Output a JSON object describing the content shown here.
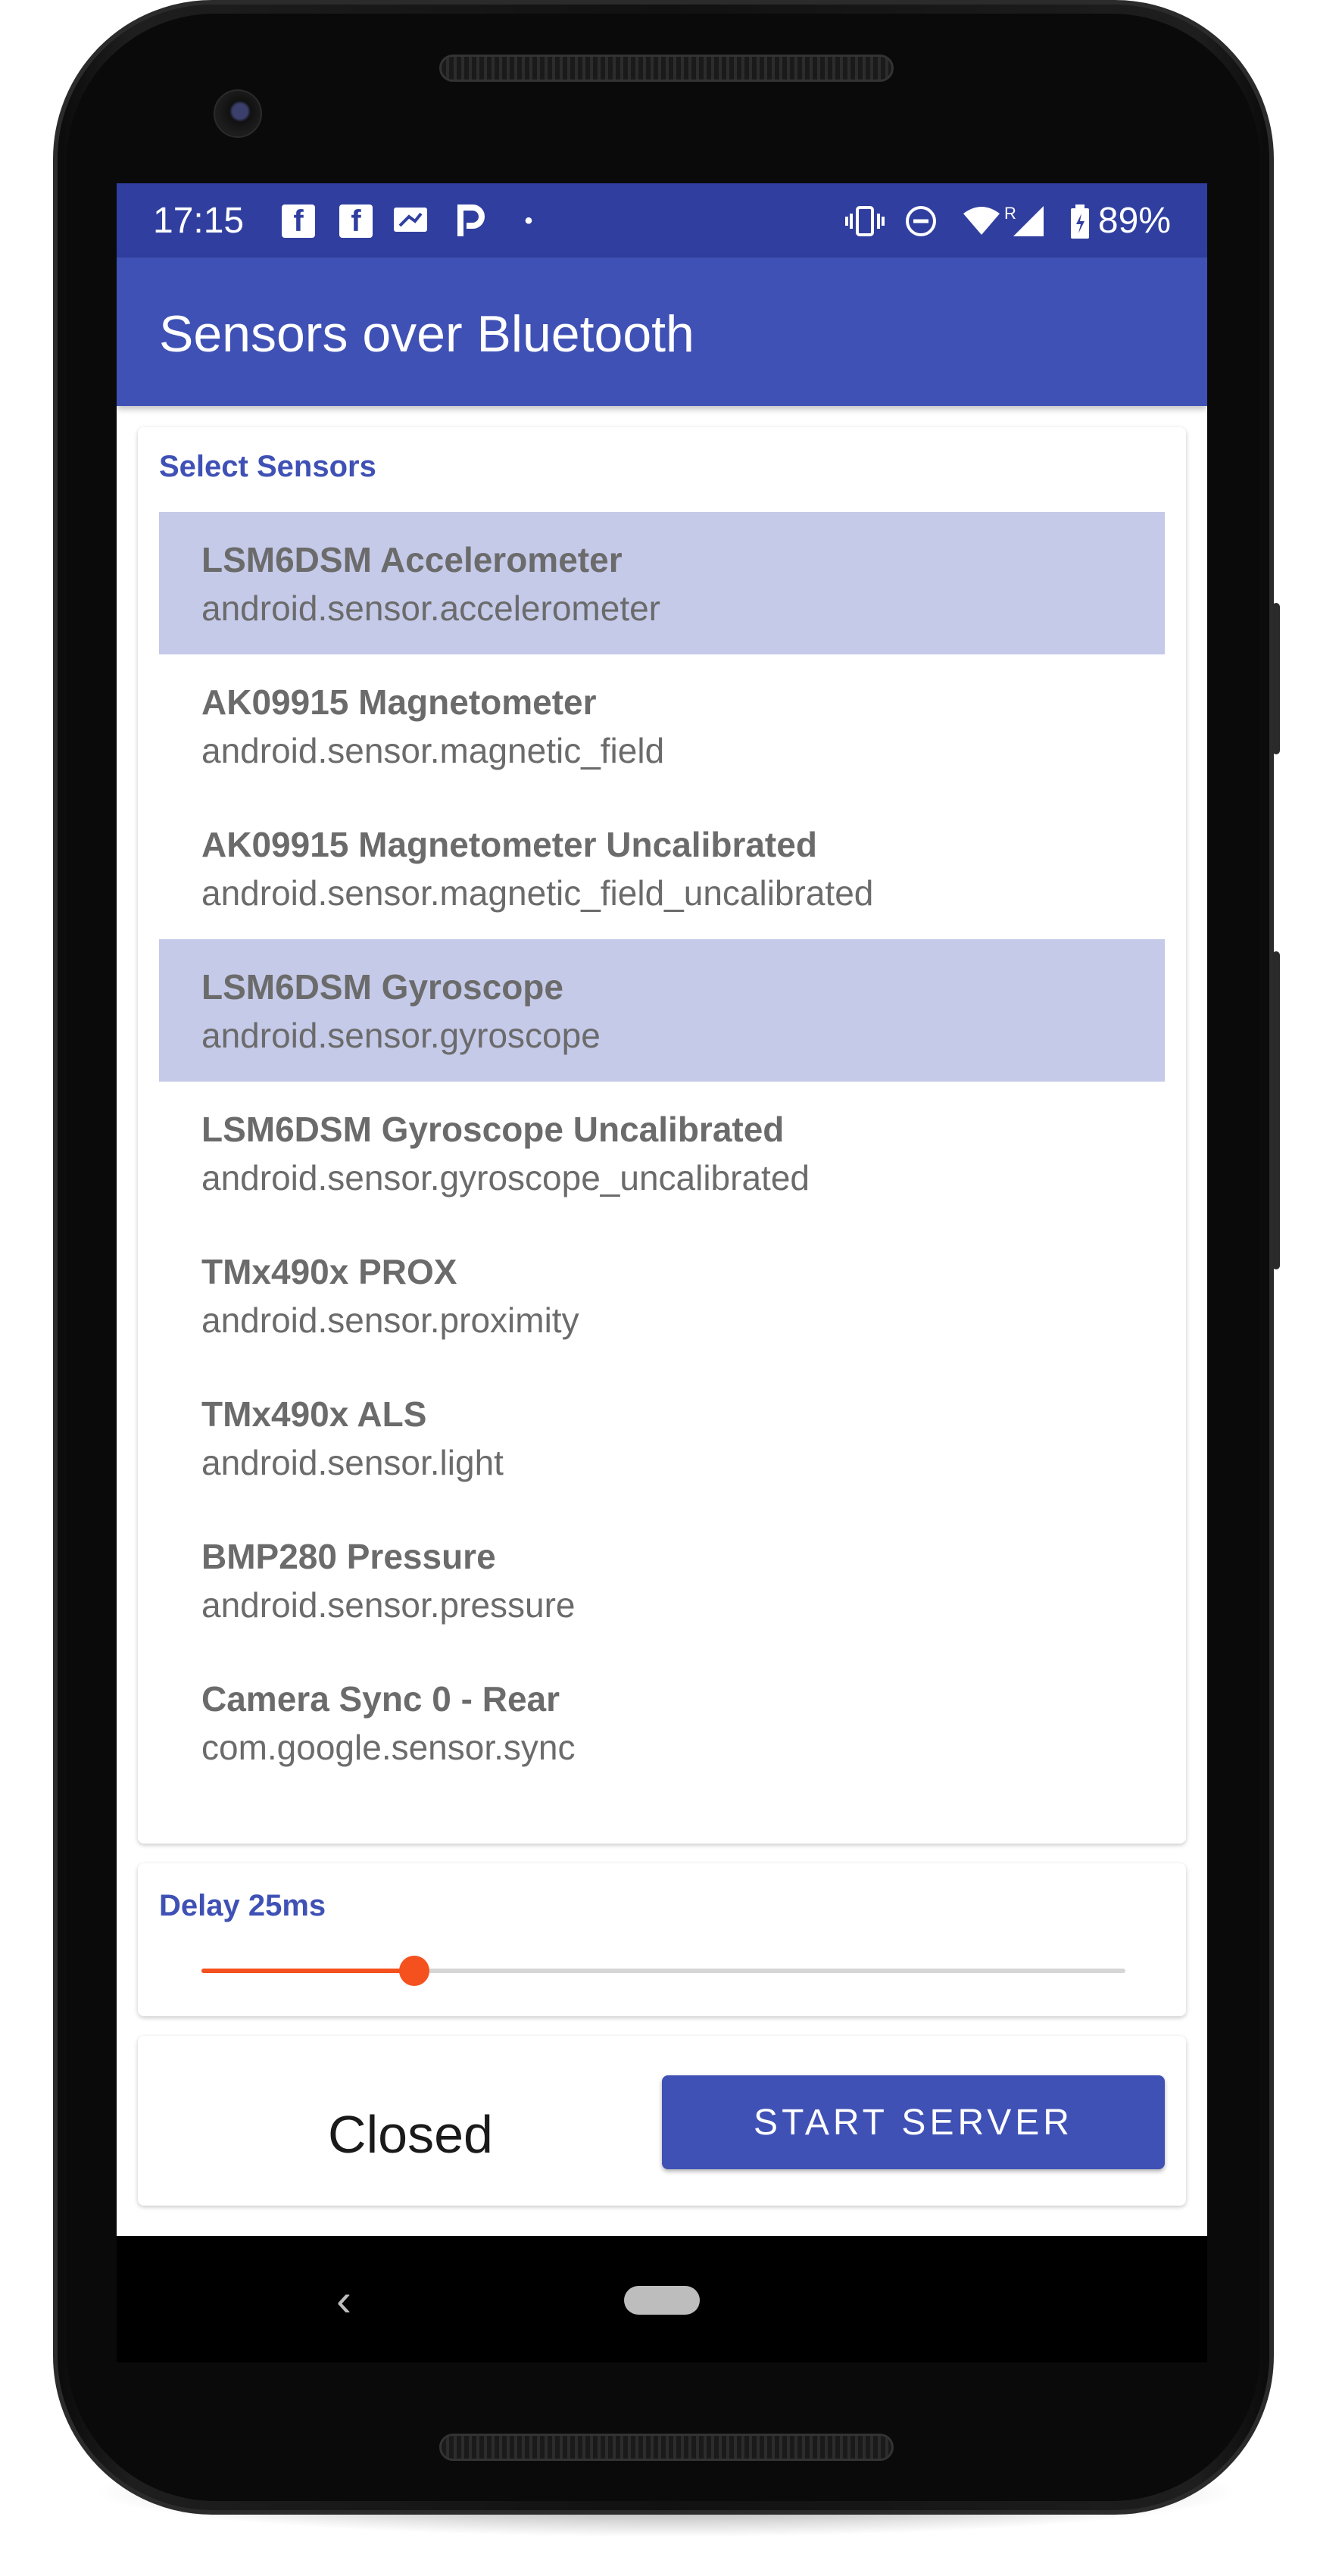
{
  "status_bar": {
    "time": "17:15",
    "left_icons": [
      "facebook-icon",
      "facebook-icon",
      "message-icon",
      "pandora-icon",
      "dot-icon"
    ],
    "right_icons": [
      "vibrate-icon",
      "dnd-icon",
      "wifi-icon",
      "signal-icon",
      "battery-icon"
    ],
    "signal_badge": "R",
    "battery": "89%"
  },
  "app_bar": {
    "title": "Sensors over Bluetooth"
  },
  "sensors_card": {
    "label": "Select Sensors",
    "items": [
      {
        "name": "LSM6DSM Accelerometer",
        "type": "android.sensor.accelerometer",
        "selected": true
      },
      {
        "name": "AK09915 Magnetometer",
        "type": "android.sensor.magnetic_field",
        "selected": false
      },
      {
        "name": "AK09915 Magnetometer Uncalibrated",
        "type": "android.sensor.magnetic_field_uncalibrated",
        "selected": false
      },
      {
        "name": "LSM6DSM Gyroscope",
        "type": "android.sensor.gyroscope",
        "selected": true
      },
      {
        "name": "LSM6DSM Gyroscope Uncalibrated",
        "type": "android.sensor.gyroscope_uncalibrated",
        "selected": false
      },
      {
        "name": "TMx490x PROX",
        "type": "android.sensor.proximity",
        "selected": false
      },
      {
        "name": "TMx490x ALS",
        "type": "android.sensor.light",
        "selected": false
      },
      {
        "name": "BMP280 Pressure",
        "type": "android.sensor.pressure",
        "selected": false
      },
      {
        "name": "Camera Sync 0 - Rear",
        "type": "com.google.sensor.sync",
        "selected": false
      }
    ]
  },
  "delay_card": {
    "label": "Delay 25ms",
    "slider_fraction": 0.23
  },
  "server_card": {
    "status": "Closed",
    "button_label": "START SERVER"
  },
  "nav_bar": {
    "back_icon": "back-icon",
    "home_icon": "home-pill-icon"
  },
  "colors": {
    "status_bar": "#303f9f",
    "app_bar": "#3f51b5",
    "selected_row": "#c5cae9",
    "accent": "#f4511e"
  }
}
